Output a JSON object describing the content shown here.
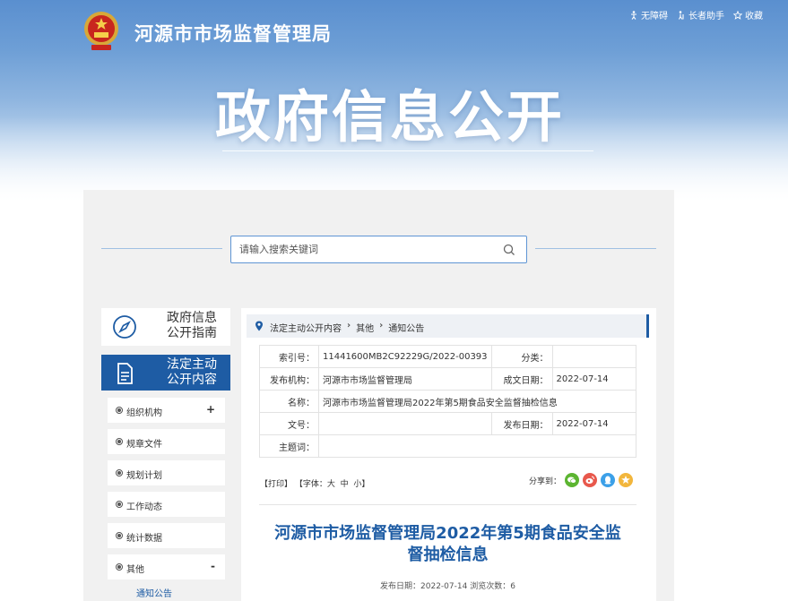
{
  "header": {
    "site_title": "河源市市场监督管理局",
    "big_title": "政府信息公开",
    "links": [
      {
        "label": "无障碍",
        "icon": "accessibility-icon"
      },
      {
        "label": "长者助手",
        "icon": "elder-icon"
      },
      {
        "label": "收藏",
        "icon": "star-icon"
      }
    ]
  },
  "search": {
    "placeholder": "请输入搜索关键词"
  },
  "sidebar": {
    "cards": [
      {
        "label": "政府信息公开指南",
        "line1": "政府信息",
        "line2": "公开指南",
        "icon": "compass-icon"
      },
      {
        "label": "法定主动公开内容",
        "line1": "法定主动",
        "line2": "公开内容",
        "icon": "document-icon"
      }
    ],
    "items": [
      {
        "label": "组织机构",
        "toggle": "+"
      },
      {
        "label": "规章文件",
        "toggle": ""
      },
      {
        "label": "规划计划",
        "toggle": ""
      },
      {
        "label": "工作动态",
        "toggle": ""
      },
      {
        "label": "统计数据",
        "toggle": ""
      },
      {
        "label": "其他",
        "toggle": "-"
      }
    ],
    "sub_item": "通知公告"
  },
  "breadcrumb": [
    "法定主动公开内容",
    "其他",
    "通知公告"
  ],
  "meta": {
    "index_label": "索引号：",
    "index_value": "11441600MB2C92229G/2022-00393",
    "category_label": "分类：",
    "category_value": "",
    "publisher_label": "发布机构：",
    "publisher_value": "河源市市场监督管理局",
    "created_label": "成文日期：",
    "created_value": "2022-07-14",
    "name_label": "名称：",
    "name_value": "河源市市场监督管理局2022年第5期食品安全监督抽检信息",
    "docno_label": "文号：",
    "docno_value": "",
    "pubdate_label": "发布日期：",
    "pubdate_value": "2022-07-14",
    "subject_label": "主题词：",
    "subject_value": ""
  },
  "tools": {
    "print": "【打印】",
    "font_label": "【字体：",
    "font_large": "大",
    "font_medium": "中",
    "font_small": "小",
    "font_close": "】",
    "share_label": "分享到："
  },
  "share_icons": [
    {
      "name": "wechat-icon",
      "color": "#5cb531"
    },
    {
      "name": "weibo-icon",
      "color": "#e8584c"
    },
    {
      "name": "qq-icon",
      "color": "#3ca0e8"
    },
    {
      "name": "qzone-icon",
      "color": "#f2b63c"
    }
  ],
  "article": {
    "title_line1": "河源市市场监督管理局2022年第5期食品安全监",
    "title_line2": "督抽检信息",
    "date_label": "发布日期：2022-07-14",
    "views_label": "浏览次数：6"
  },
  "colors": {
    "accent": "#1e5ca4",
    "banner_top": "#5a8fcf"
  }
}
